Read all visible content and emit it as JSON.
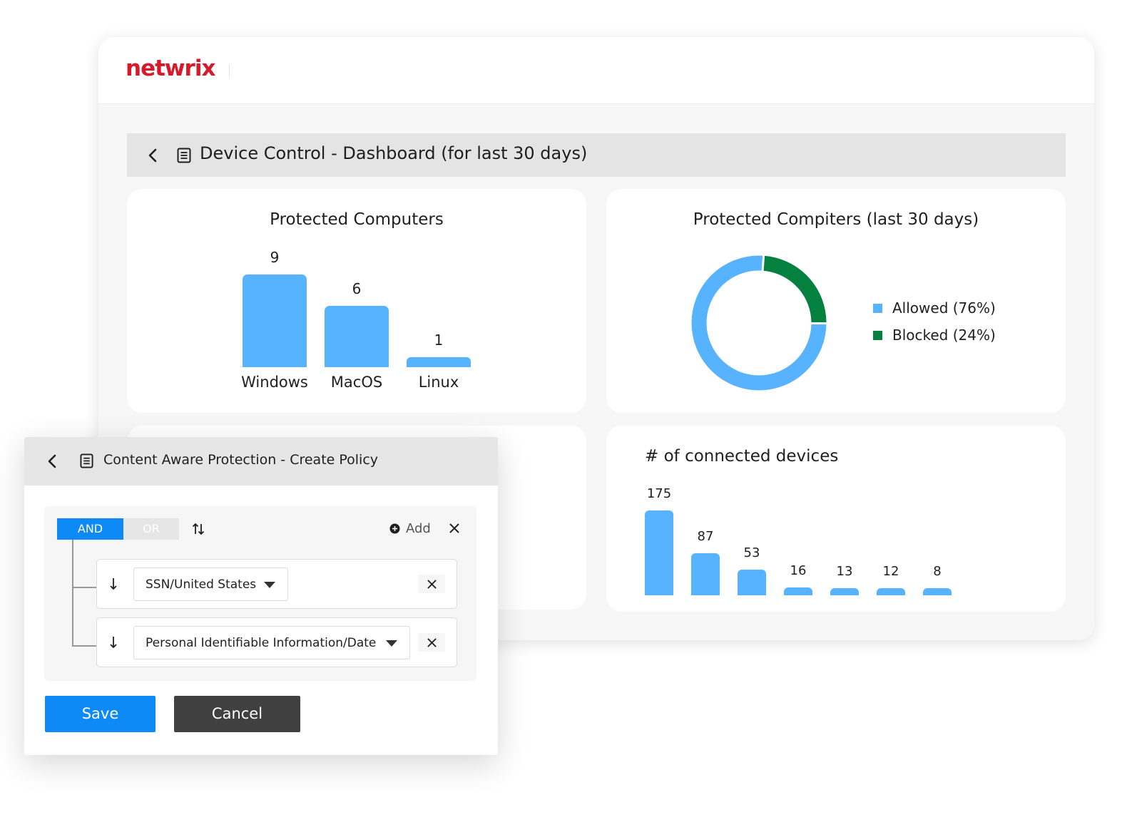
{
  "brand": {
    "logo_text": "netwrix",
    "logo_color": "#d71a2b"
  },
  "dashboard": {
    "title": "Device Control - Dashboard (for last 30 days)",
    "protected_computers": {
      "title": "Protected Computers",
      "chart_data": {
        "type": "bar",
        "categories": [
          "Windows",
          "MacOS",
          "Linux"
        ],
        "values": [
          9,
          6,
          1
        ],
        "color": "#57b3fe"
      }
    },
    "protected_30": {
      "title": "Protected Compiters (last 30 days)",
      "chart_data": {
        "type": "pie",
        "style": "donut",
        "categories": [
          "Allowed (76%)",
          "Blocked (24%)"
        ],
        "values": [
          76,
          24
        ],
        "colors": [
          "#57b3fe",
          "#04803f"
        ],
        "legend": "right"
      }
    },
    "connected_devices": {
      "title": "# of connected devices",
      "chart_data": {
        "type": "bar",
        "values": [
          175,
          87,
          53,
          16,
          13,
          12,
          8
        ],
        "color": "#57b3fe"
      }
    }
  },
  "policy_panel": {
    "title": "Content Aware Protection - Create Policy",
    "and_label": "AND",
    "or_label": "OR",
    "add_label": "Add",
    "conditions": [
      {
        "value": "SSN/United States"
      },
      {
        "value": "Personal Identifiable Information/Date"
      }
    ],
    "save_label": "Save",
    "cancel_label": "Cancel",
    "colors": {
      "primary": "#0d8af5",
      "secondary": "#404040"
    }
  }
}
